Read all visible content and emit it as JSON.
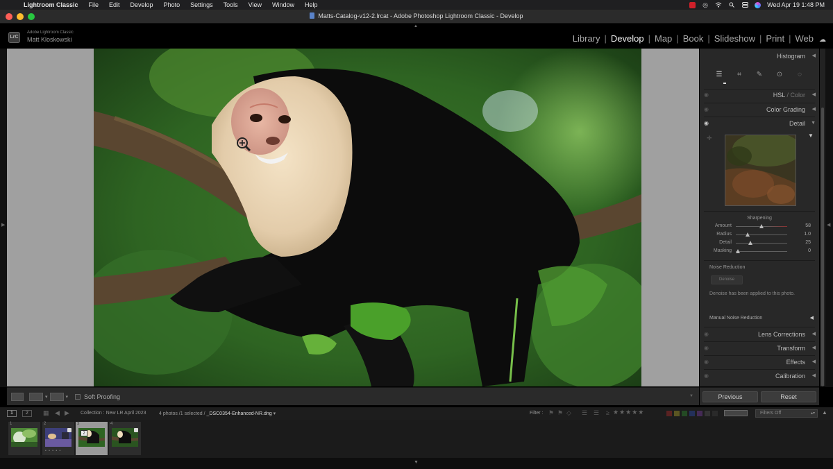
{
  "menubar": {
    "app_name": "Lightroom Classic",
    "items": [
      "File",
      "Edit",
      "Develop",
      "Photo",
      "Settings",
      "Tools",
      "View",
      "Window",
      "Help"
    ],
    "clock": "Wed Apr 19  1:48 PM"
  },
  "window": {
    "title": "Matts-Catalog-v12-2.lrcat - Adobe Photoshop Lightroom Classic - Develop"
  },
  "identity": {
    "logo": "LrC",
    "product": "Adobe Lightroom Classic",
    "user": "Matt Kloskowski"
  },
  "modules": [
    {
      "label": "Library",
      "active": false
    },
    {
      "label": "Develop",
      "active": true
    },
    {
      "label": "Map",
      "active": false
    },
    {
      "label": "Book",
      "active": false
    },
    {
      "label": "Slideshow",
      "active": false
    },
    {
      "label": "Print",
      "active": false
    },
    {
      "label": "Web",
      "active": false
    }
  ],
  "toolbar": {
    "soft_proofing": "Soft Proofing"
  },
  "right_panel": {
    "histogram": "Histogram",
    "hsl": "HSL",
    "hsl_suffix": " / Color",
    "color_grading": "Color Grading",
    "detail": "Detail",
    "sharpening_title": "Sharpening",
    "sharpening": [
      {
        "label": "Amount",
        "value": "58",
        "fraction": 0.5
      },
      {
        "label": "Radius",
        "value": "1.0",
        "fraction": 0.23
      },
      {
        "label": "Detail",
        "value": "25",
        "fraction": 0.28
      },
      {
        "label": "Masking",
        "value": "0",
        "fraction": 0.04
      }
    ],
    "noise_reduction_title": "Noise Reduction",
    "denoise_button": "Denoise",
    "denoise_note": "Denoise has been applied to this photo.",
    "manual_noise_reduction": "Manual Noise Reduction",
    "lens_corrections": "Lens Corrections",
    "transform": "Transform",
    "effects": "Effects",
    "calibration": "Calibration",
    "previous_button": "Previous",
    "reset_button": "Reset"
  },
  "filmstrip_bar": {
    "screen1": "1",
    "screen2": "2",
    "collection": "Collection : New LR April 2023",
    "selection_prefix": "4 photos /1 selected /",
    "selection_file": "_DSC0354-Enhanced-NR.dng",
    "filter_label": "Filter :",
    "filters_off": "Filters Off"
  },
  "filmstrip": [
    {
      "num": "1",
      "selected": false
    },
    {
      "num": "2",
      "selected": false,
      "dots": "• • • • •"
    },
    {
      "num": "3",
      "selected": true,
      "badge": "2"
    },
    {
      "num": "4",
      "selected": false
    }
  ],
  "colors": {
    "accent_active_module": "#f2f2f2",
    "panel_bg": "#282828",
    "workspace_bg": "#a0a0a0"
  }
}
